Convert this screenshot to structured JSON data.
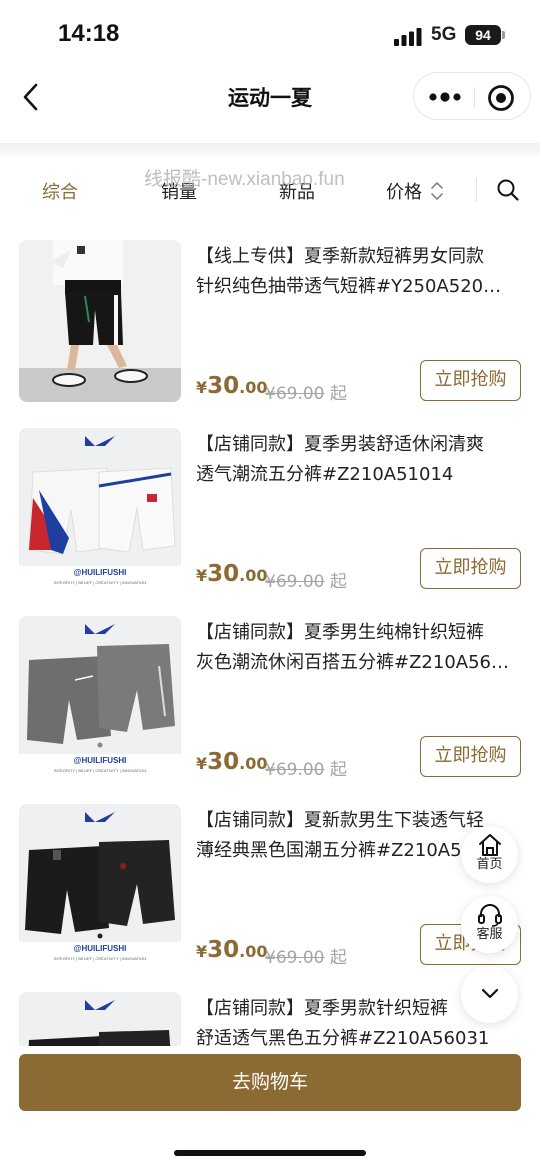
{
  "status": {
    "time": "14:18",
    "network": "5G",
    "battery": "94"
  },
  "nav": {
    "title": "运动一夏"
  },
  "watermark": "线报酷-new.xianbao.fun",
  "tabs": [
    {
      "label": "综合",
      "active": true
    },
    {
      "label": "销量",
      "active": false
    },
    {
      "label": "新品",
      "active": false
    },
    {
      "label": "价格",
      "active": false
    }
  ],
  "products": [
    {
      "title_line1": "【线上专供】夏季新款短裤男女同款",
      "title_line2": "针织纯色抽带透气短裤#Y250A520…",
      "currency": "¥",
      "price_int": "30",
      "price_dec": ".00",
      "orig_price": "¥69.00",
      "orig_suffix": "起",
      "button": "立即抢购",
      "image": "model-black-shorts"
    },
    {
      "title_line1": "【店铺同款】夏季男装舒适休闲清爽",
      "title_line2": "透气潮流五分裤#Z210A51014",
      "currency": "¥",
      "price_int": "30",
      "price_dec": ".00",
      "orig_price": "¥69.00",
      "orig_suffix": "起",
      "button": "立即抢购",
      "image": "white-shorts",
      "brand": "@HUILIFUSHI",
      "tagline": "INTEGRITY | BELIEF | CREATIVITY | INNOVATION"
    },
    {
      "title_line1": "【店铺同款】夏季男生纯棉针织短裤",
      "title_line2": "灰色潮流休闲百搭五分裤#Z210A56…",
      "currency": "¥",
      "price_int": "30",
      "price_dec": ".00",
      "orig_price": "¥69.00",
      "orig_suffix": "起",
      "button": "立即抢购",
      "image": "grey-shorts",
      "brand": "@HUILIFUSHI",
      "tagline": "INTEGRITY | BELIEF | CREATIVITY | INNOVATION"
    },
    {
      "title_line1": "【店铺同款】夏新款男生下装透气轻",
      "title_line2": "薄经典黑色国潮五分裤#Z210A5",
      "currency": "¥",
      "price_int": "30",
      "price_dec": ".00",
      "orig_price": "¥69.00",
      "orig_suffix": "起",
      "button": "立即抢购",
      "image": "black-shorts",
      "brand": "@HUILIFUSHI",
      "tagline": "INTEGRITY | BELIEF | CREATIVITY | INNOVATION"
    },
    {
      "title_line1": "【店铺同款】夏季男款针织短裤",
      "title_line2": "舒适透气黑色五分裤#Z210A56031",
      "image": "black-shorts-2"
    }
  ],
  "side": {
    "home": "首页",
    "service": "客服"
  },
  "cart": {
    "label": "去购物车"
  },
  "colors": {
    "accent": "#8c6a33",
    "brand_blue": "#1e3fa0"
  }
}
